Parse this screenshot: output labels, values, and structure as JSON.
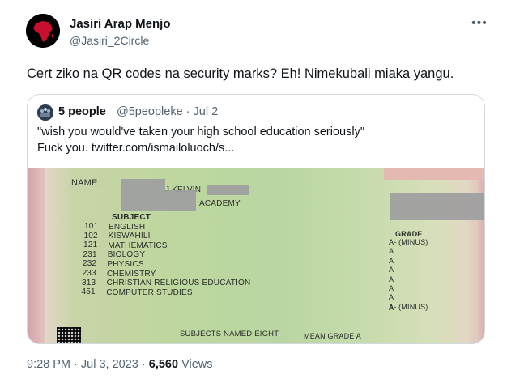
{
  "author": {
    "name": "Jasiri Arap Menjo",
    "handle": "@Jasiri_2Circle"
  },
  "tweet": {
    "text": "Cert ziko na QR codes na security marks? Eh! Nimekubali miaka yangu."
  },
  "quoted": {
    "name": "5 people",
    "handle": "@5peopleke",
    "separator": "·",
    "date": "Jul 2",
    "line1": "\"wish you would've taken your high school education seriously\"",
    "line2": "Fuck you.  twitter.com/ismailoluoch/s..."
  },
  "certificate": {
    "name_label": "NAME:",
    "name_value": "J KELVIN",
    "school": "ACADEMY",
    "subject_header": "SUBJECT",
    "grade_header": "GRADE",
    "subjects": [
      {
        "code": "101",
        "name": "ENGLISH",
        "grade": "A- (MINUS)"
      },
      {
        "code": "102",
        "name": "KISWAHILI",
        "grade": "A"
      },
      {
        "code": "121",
        "name": "MATHEMATICS",
        "grade": "A"
      },
      {
        "code": "231",
        "name": "BIOLOGY",
        "grade": "A"
      },
      {
        "code": "232",
        "name": "PHYSICS",
        "grade": "A"
      },
      {
        "code": "233",
        "name": "CHEMISTRY",
        "grade": "A"
      },
      {
        "code": "313",
        "name": "CHRISTIAN RELIGIOUS EDUCATION",
        "grade": "A"
      },
      {
        "code": "451",
        "name": "COMPUTER STUDIES",
        "grade": "A- (MINUS)"
      }
    ],
    "extra_grade": "A",
    "subjects_named": "SUBJECTS NAMED EIGHT",
    "mean_grade": "MEAN GRADE A"
  },
  "footer": {
    "time": "9:28 PM",
    "sep1": "·",
    "date": "Jul 3, 2023",
    "sep2": "·",
    "views_count": "6,560",
    "views_label": "Views"
  },
  "colors": {
    "text_primary": "#0f1419",
    "text_secondary": "#536471",
    "border": "#cfd9de",
    "avatar_bg": "#000000",
    "africa_red": "#c8102e"
  },
  "icons": {
    "more": "more-dots-icon",
    "avatar": "africa-map-avatar",
    "quoted_avatar": "quoted-user-avatar",
    "qr": "qr-code-mark"
  }
}
